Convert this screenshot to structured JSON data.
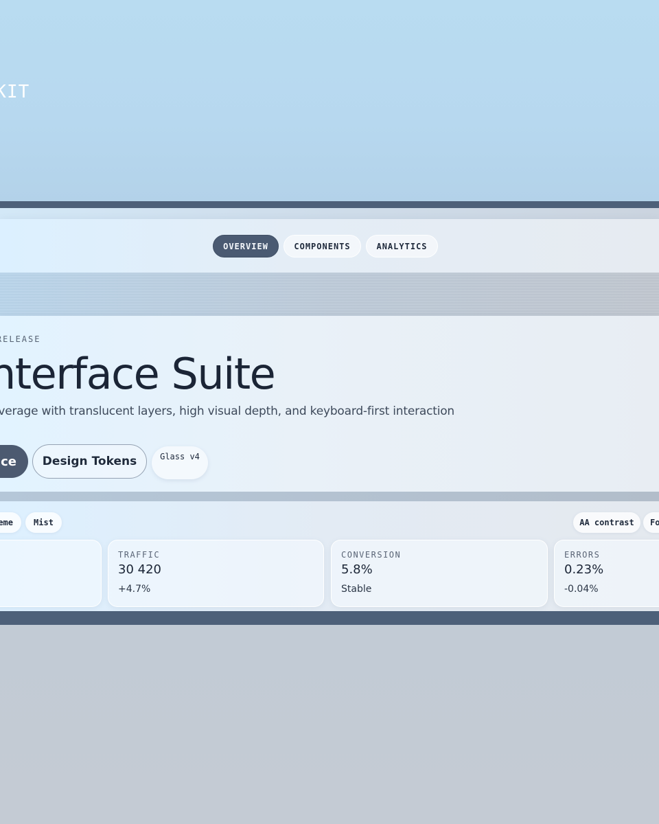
{
  "brand": {
    "name": "N-KIT"
  },
  "nav": {
    "tabs": [
      {
        "label": "OVERVIEW",
        "active": true
      },
      {
        "label": "COMPONENTS",
        "active": false
      },
      {
        "label": "ANALYTICS",
        "active": false
      }
    ]
  },
  "hero": {
    "eyebrow": "CED RELEASE",
    "title": "nterface Suite",
    "subtitle": "coverage with translucent layers, high visual depth, and keyboard-first interaction",
    "primary_button": "ce",
    "secondary_button": "Design Tokens",
    "version_badge": "Glass v4"
  },
  "toolbar": {
    "left_chips": [
      "eme",
      "Mist"
    ],
    "right_chips": [
      "AA contrast",
      "Fo"
    ]
  },
  "metrics": [
    {
      "label": "TRAFFIC",
      "value": "30 420",
      "delta": "+4.7%"
    },
    {
      "label": "CONVERSION",
      "value": "5.8%",
      "delta": "Stable"
    },
    {
      "label": "ERRORS",
      "value": "0.23%",
      "delta": "-0.04%"
    }
  ],
  "colors": {
    "accent_dark": "#4a5a72",
    "frame": "#4d6079",
    "text_primary": "#1b2536",
    "sky": "#b9dcf1"
  }
}
